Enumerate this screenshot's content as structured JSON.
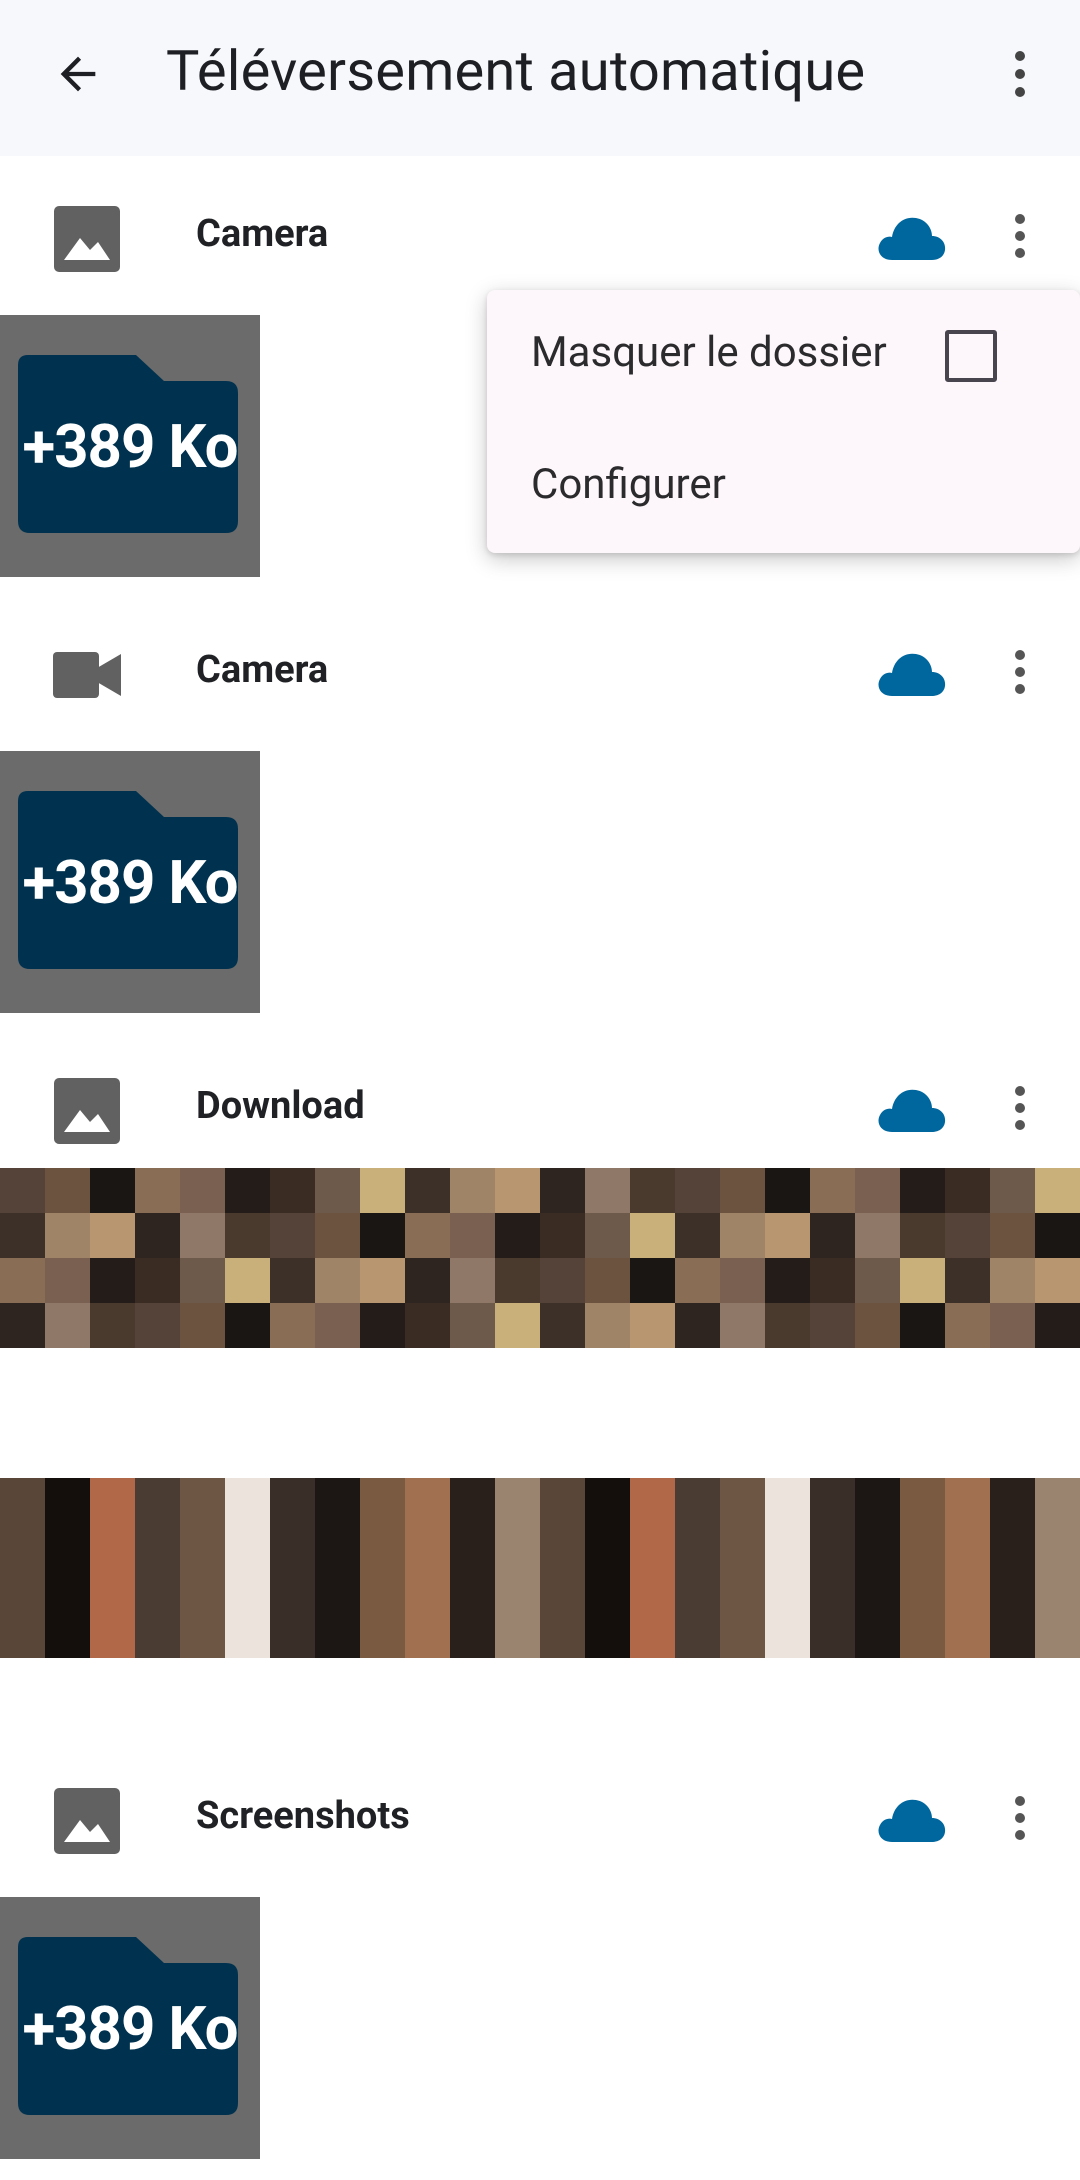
{
  "appbar": {
    "title": "Téléversement automatique",
    "back_icon": "arrow-back-icon",
    "menu_icon": "more-vert-icon"
  },
  "colors": {
    "appbar_bg": "#f7f8fc",
    "cloud": "#00679e",
    "folder_fill": "#00324f",
    "thumb_bg": "#6b6b6b",
    "icon_gray": "#616161"
  },
  "sections": [
    {
      "name": "Camera",
      "type_icon": "image-icon",
      "status_icon": "cloud-icon",
      "menu_icon": "more-vert-icon",
      "thumb_label": "+389 Ko"
    },
    {
      "name": "Camera",
      "type_icon": "videocam-icon",
      "status_icon": "cloud-icon",
      "menu_icon": "more-vert-icon",
      "thumb_label": "+389 Ko"
    },
    {
      "name": "Download",
      "type_icon": "image-icon",
      "status_icon": "cloud-icon",
      "menu_icon": "more-vert-icon"
    },
    {
      "name": "Screenshots",
      "type_icon": "image-icon",
      "status_icon": "cloud-icon",
      "menu_icon": "more-vert-icon",
      "thumb_label": "+389 Ko"
    }
  ],
  "popup_menu": {
    "hide_folder": "Masquer le dossier",
    "hide_folder_checked": false,
    "configure": "Configurer"
  }
}
